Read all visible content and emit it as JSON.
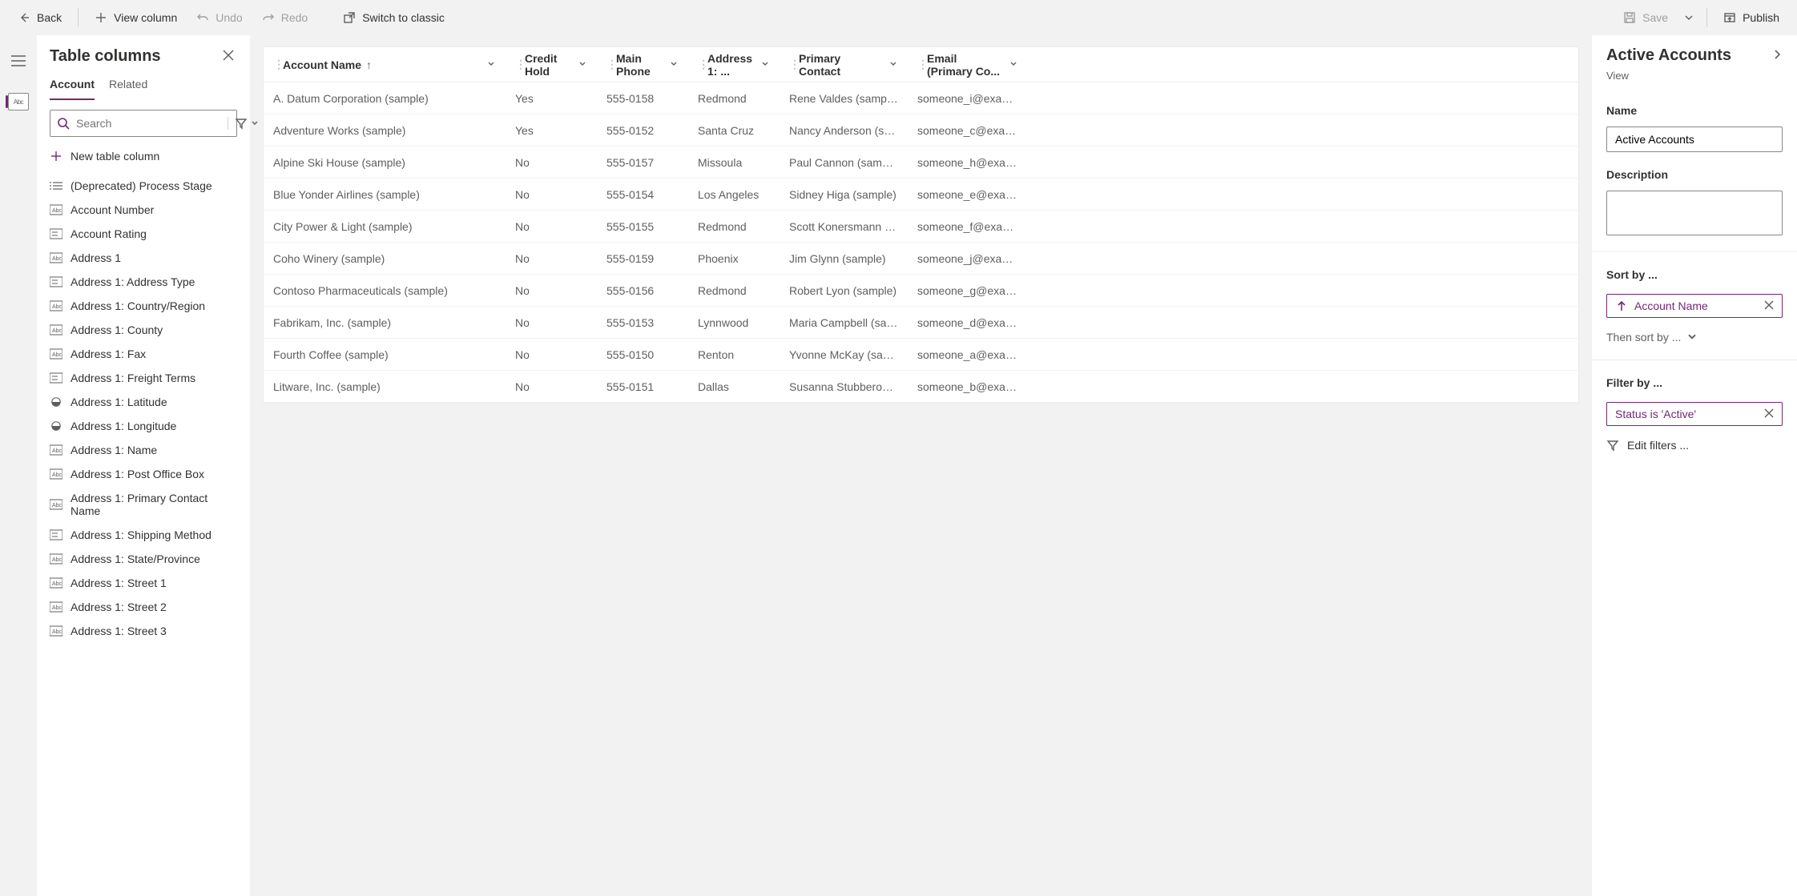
{
  "toolbar": {
    "back": "Back",
    "view_column": "View column",
    "undo": "Undo",
    "redo": "Redo",
    "switch": "Switch to classic",
    "save": "Save",
    "publish": "Publish"
  },
  "columns_panel": {
    "title": "Table columns",
    "tabs": {
      "account": "Account",
      "related": "Related"
    },
    "search_placeholder": "Search",
    "new_column_label": "New table column",
    "fields": [
      {
        "type": "list",
        "label": "(Deprecated) Process Stage"
      },
      {
        "type": "text",
        "label": "Account Number"
      },
      {
        "type": "option",
        "label": "Account Rating"
      },
      {
        "type": "text",
        "label": "Address 1"
      },
      {
        "type": "option",
        "label": "Address 1: Address Type"
      },
      {
        "type": "text",
        "label": "Address 1: Country/Region"
      },
      {
        "type": "text",
        "label": "Address 1: County"
      },
      {
        "type": "text",
        "label": "Address 1: Fax"
      },
      {
        "type": "option",
        "label": "Address 1: Freight Terms"
      },
      {
        "type": "geo",
        "label": "Address 1: Latitude"
      },
      {
        "type": "geo",
        "label": "Address 1: Longitude"
      },
      {
        "type": "text",
        "label": "Address 1: Name"
      },
      {
        "type": "text",
        "label": "Address 1: Post Office Box"
      },
      {
        "type": "text",
        "label": "Address 1: Primary Contact Name"
      },
      {
        "type": "option",
        "label": "Address 1: Shipping Method"
      },
      {
        "type": "text",
        "label": "Address 1: State/Province"
      },
      {
        "type": "text",
        "label": "Address 1: Street 1"
      },
      {
        "type": "text",
        "label": "Address 1: Street 2"
      },
      {
        "type": "text",
        "label": "Address 1: Street 3"
      }
    ]
  },
  "grid": {
    "columns": [
      {
        "label": "Account Name",
        "sorted": "asc",
        "key": "name",
        "cls": "col-name"
      },
      {
        "label": "Credit Hold",
        "key": "credit",
        "cls": "col-credit"
      },
      {
        "label": "Main Phone",
        "key": "phone",
        "cls": "col-phone"
      },
      {
        "label": "Address 1: ...",
        "key": "addr",
        "cls": "col-addr"
      },
      {
        "label": "Primary Contact",
        "key": "contact",
        "cls": "col-contact"
      },
      {
        "label": "Email (Primary Co...",
        "key": "email",
        "cls": "col-email"
      }
    ],
    "rows": [
      {
        "name": "A. Datum Corporation (sample)",
        "credit": "Yes",
        "phone": "555-0158",
        "addr": "Redmond",
        "contact": "Rene Valdes (sample)",
        "email": "someone_i@example.com"
      },
      {
        "name": "Adventure Works (sample)",
        "credit": "Yes",
        "phone": "555-0152",
        "addr": "Santa Cruz",
        "contact": "Nancy Anderson (sample)",
        "email": "someone_c@example.com"
      },
      {
        "name": "Alpine Ski House (sample)",
        "credit": "No",
        "phone": "555-0157",
        "addr": "Missoula",
        "contact": "Paul Cannon (sample)",
        "email": "someone_h@example.com"
      },
      {
        "name": "Blue Yonder Airlines (sample)",
        "credit": "No",
        "phone": "555-0154",
        "addr": "Los Angeles",
        "contact": "Sidney Higa (sample)",
        "email": "someone_e@example.com"
      },
      {
        "name": "City Power & Light (sample)",
        "credit": "No",
        "phone": "555-0155",
        "addr": "Redmond",
        "contact": "Scott Konersmann (sample)",
        "email": "someone_f@example.com"
      },
      {
        "name": "Coho Winery (sample)",
        "credit": "No",
        "phone": "555-0159",
        "addr": "Phoenix",
        "contact": "Jim Glynn (sample)",
        "email": "someone_j@example.com"
      },
      {
        "name": "Contoso Pharmaceuticals (sample)",
        "credit": "No",
        "phone": "555-0156",
        "addr": "Redmond",
        "contact": "Robert Lyon (sample)",
        "email": "someone_g@example.com"
      },
      {
        "name": "Fabrikam, Inc. (sample)",
        "credit": "No",
        "phone": "555-0153",
        "addr": "Lynnwood",
        "contact": "Maria Campbell (sample)",
        "email": "someone_d@example.com"
      },
      {
        "name": "Fourth Coffee (sample)",
        "credit": "No",
        "phone": "555-0150",
        "addr": "Renton",
        "contact": "Yvonne McKay (sample)",
        "email": "someone_a@example.com"
      },
      {
        "name": "Litware, Inc. (sample)",
        "credit": "No",
        "phone": "555-0151",
        "addr": "Dallas",
        "contact": "Susanna Stubberod (sampl...",
        "email": "someone_b@example.com"
      }
    ]
  },
  "details": {
    "title": "Active Accounts",
    "subtitle": "View",
    "name_label": "Name",
    "name_value": "Active Accounts",
    "description_label": "Description",
    "sort_label": "Sort by ...",
    "sort_chip": "Account Name",
    "then_sort": "Then sort by ...",
    "filter_label": "Filter by ...",
    "filter_chip": "Status is 'Active'",
    "edit_filters": "Edit filters ..."
  }
}
